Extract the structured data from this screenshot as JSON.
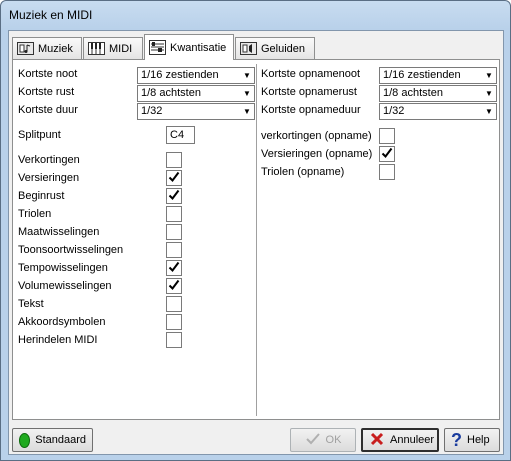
{
  "window": {
    "title": "Muziek en MIDI"
  },
  "tabs": [
    {
      "label": "Muziek",
      "icon": "music-note-icon",
      "active": false
    },
    {
      "label": "MIDI",
      "icon": "piano-keys-icon",
      "active": false
    },
    {
      "label": "Kwantisatie",
      "icon": "quantize-grid-icon",
      "active": true
    },
    {
      "label": "Geluiden",
      "icon": "speaker-icon",
      "active": false
    }
  ],
  "left": {
    "kortste_noot_label": "Kortste noot",
    "kortste_noot_value": "1/16 zestienden",
    "kortste_rust_label": "Kortste rust",
    "kortste_rust_value": "1/8  achtsten",
    "kortste_duur_label": "Kortste duur",
    "kortste_duur_value": "1/32",
    "splitpunt_label": "Splitpunt",
    "splitpunt_value": "C4",
    "checks": [
      {
        "label": "Verkortingen",
        "checked": false
      },
      {
        "label": "Versieringen",
        "checked": true
      },
      {
        "label": "Beginrust",
        "checked": true
      },
      {
        "label": "Triolen",
        "checked": false
      },
      {
        "label": "Maatwisselingen",
        "checked": false
      },
      {
        "label": "Toonsoortwisselingen",
        "checked": false
      },
      {
        "label": "Tempowisselingen",
        "checked": true
      },
      {
        "label": "Volumewisselingen",
        "checked": true
      },
      {
        "label": "Tekst",
        "checked": false
      },
      {
        "label": "Akkoordsymbolen",
        "checked": false
      },
      {
        "label": "Herindelen MIDI",
        "checked": false
      }
    ]
  },
  "right": {
    "opnamenoot_label": "Kortste opnamenoot",
    "opnamenoot_value": "1/16 zestienden",
    "opnamerust_label": "Kortste opnamerust",
    "opnamerust_value": "1/8  achtsten",
    "opnameduur_label": "Kortste opnameduur",
    "opnameduur_value": "1/32",
    "checks": [
      {
        "label": "verkortingen (opname)",
        "checked": false
      },
      {
        "label": "Versieringen  (opname)",
        "checked": true
      },
      {
        "label": "Triolen  (opname)",
        "checked": false
      }
    ]
  },
  "buttons": {
    "standaard": "Standaard",
    "ok": "OK",
    "annuleer": "Annuleer",
    "help": "Help"
  },
  "colors": {
    "titlebar": "#b9d1ea",
    "panel": "#f0f0f0",
    "standaard_dot": "#1faa1f",
    "cancel_x": "#c81e1e",
    "help_q": "#1a3c9e"
  }
}
